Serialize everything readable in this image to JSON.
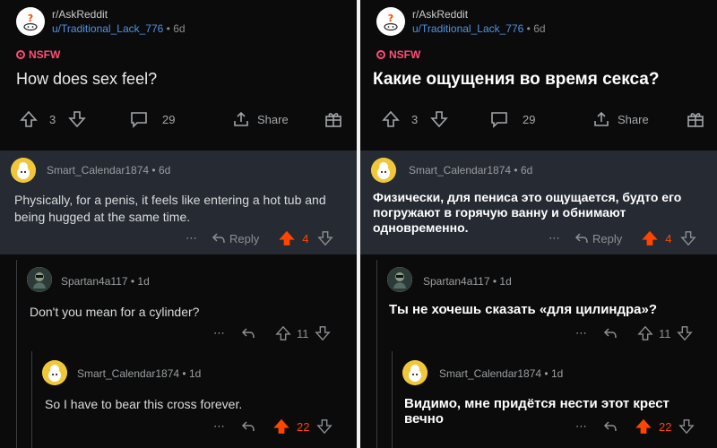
{
  "post": {
    "subreddit": "r/AskReddit",
    "author": "u/Traditional_Lack_776",
    "age": "6d",
    "nsfw_label": "NSFW",
    "title_en": "How does sex feel?",
    "title_ru": "Какие ощущения во время секса?",
    "upvotes": "3",
    "comments": "29",
    "share_label": "Share"
  },
  "comments": {
    "c1": {
      "author": "Smart_Calendar1874",
      "age": "6d",
      "body_en": "Physically, for a penis, it feels like entering a hot tub and being hugged at the same time.",
      "body_ru": "Физически, для пениса это ощущается, будто его погружают в горячую ванну и обнимают одновременно.",
      "reply_label": "Reply",
      "score": "4"
    },
    "c2": {
      "author": "Spartan4a117",
      "age": "1d",
      "body_en": "Don't you mean for a cylinder?",
      "body_ru": "Ты не хочешь сказать «для цилиндра»?",
      "score": "11"
    },
    "c3": {
      "author": "Smart_Calendar1874",
      "age": "1d",
      "body_en": "So I have to bear this cross forever.",
      "body_ru": "Видимо, мне придётся нести этот крест вечно",
      "score": "22"
    }
  },
  "colors": {
    "upvote": "#ff4500",
    "nsfw": "#ff4f73",
    "username_link": "#4e93e6",
    "highlight_bg": "#252a33"
  },
  "icons": [
    "subreddit-avatar-icon",
    "nsfw-icon",
    "upvote-icon",
    "downvote-icon",
    "comment-icon",
    "share-icon",
    "award-icon",
    "more-icon",
    "reply-icon",
    "user-avatar-icon"
  ]
}
